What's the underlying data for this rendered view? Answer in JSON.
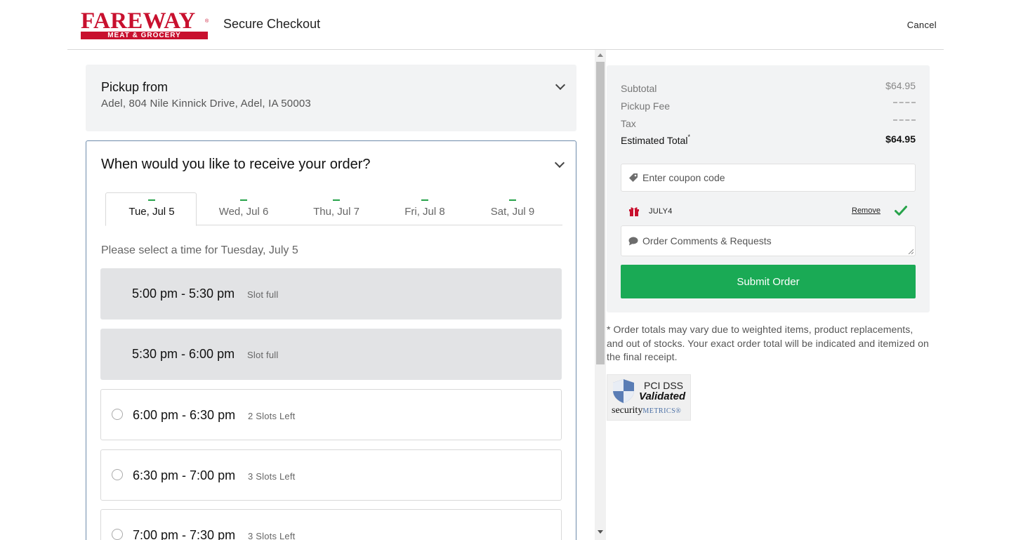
{
  "header": {
    "logo_text": "FAREWAY",
    "logo_subtext": "MEAT & GROCERY",
    "title": "Secure Checkout",
    "cancel_label": "Cancel"
  },
  "pickup": {
    "title": "Pickup from",
    "address": "Adel, 804 Nile Kinnick Drive, Adel, IA 50003"
  },
  "schedule": {
    "title": "When would you like to receive your order?",
    "tabs": [
      {
        "label": "Tue, Jul 5",
        "active": true
      },
      {
        "label": "Wed, Jul 6",
        "active": false
      },
      {
        "label": "Thu, Jul 7",
        "active": false
      },
      {
        "label": "Fri, Jul 8",
        "active": false
      },
      {
        "label": "Sat, Jul 9",
        "active": false
      }
    ],
    "select_prompt": "Please select a time for Tuesday, July 5",
    "slots": [
      {
        "time": "5:00 pm - 5:30 pm",
        "status": "Slot full",
        "available": false
      },
      {
        "time": "5:30 pm - 6:00 pm",
        "status": "Slot full",
        "available": false
      },
      {
        "time": "6:00 pm - 6:30 pm",
        "status": "2 Slots Left",
        "available": true
      },
      {
        "time": "6:30 pm - 7:00 pm",
        "status": "3 Slots Left",
        "available": true
      },
      {
        "time": "7:00 pm - 7:30 pm",
        "status": "3 Slots Left",
        "available": true
      }
    ]
  },
  "summary": {
    "subtotal_label": "Subtotal",
    "subtotal_value": "$64.95",
    "pickup_fee_label": "Pickup Fee",
    "tax_label": "Tax",
    "total_label": "Estimated Total",
    "total_marker": "*",
    "total_value": "$64.95",
    "coupon_placeholder": "Enter coupon code",
    "applied_coupon": "JULY4",
    "remove_label": "Remove",
    "comments_placeholder": "Order Comments & Requests",
    "submit_label": "Submit Order"
  },
  "disclaimer": "* Order totals may vary due to weighted items, product replacements, and out of stocks. Your exact order total will be indicated and itemized on the final receipt.",
  "badge": {
    "line1": "PCI DSS",
    "line2": "Validated",
    "brand_a": "security",
    "brand_b": "METRICS",
    "brand_mark": "®"
  },
  "icons": [
    "chevron-down-icon",
    "tag-icon",
    "gift-icon",
    "check-icon",
    "comment-icon",
    "shield-icon"
  ],
  "colors": {
    "brand_red": "#c8102e",
    "submit_green": "#1aaa55",
    "check_green": "#27a34a",
    "panel_gray": "#f2f3f4",
    "slot_full_gray": "#e2e3e5"
  }
}
